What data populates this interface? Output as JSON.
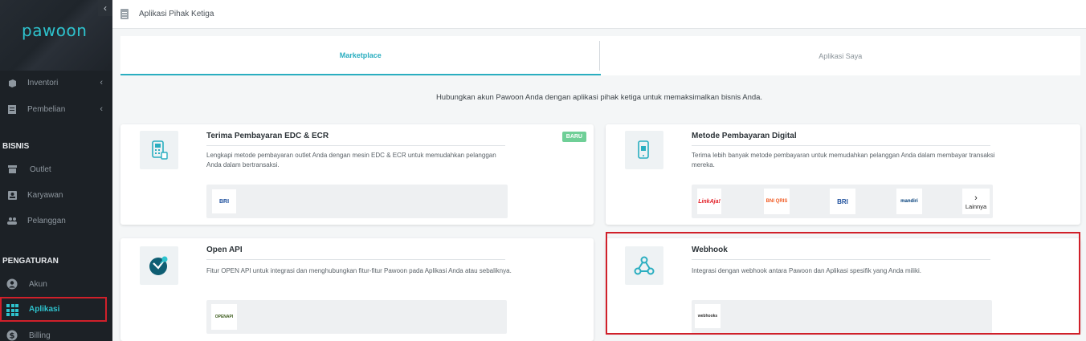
{
  "sidebar": {
    "logo": "pawoon",
    "collapse_icon": "‹",
    "items_top": [
      {
        "label": "Inventori",
        "icon": "box-icon"
      },
      {
        "label": "Pembelian",
        "icon": "clipboard-icon"
      }
    ],
    "section_bisnis": "BISNIS",
    "items_bisnis": [
      {
        "label": "Outlet",
        "icon": "store-icon"
      },
      {
        "label": "Karyawan",
        "icon": "id-card-icon"
      },
      {
        "label": "Pelanggan",
        "icon": "users-icon"
      }
    ],
    "section_pengaturan": "PENGATURAN",
    "items_pengaturan": [
      {
        "label": "Akun",
        "icon": "user-circle-icon"
      },
      {
        "label": "Aplikasi",
        "icon": "grid-icon"
      },
      {
        "label": "Billing",
        "icon": "dollar-icon"
      }
    ]
  },
  "header": {
    "breadcrumb": "Aplikasi Pihak Ketiga"
  },
  "tabs": [
    {
      "label": "Marketplace",
      "active": true
    },
    {
      "label": "Aplikasi Saya",
      "active": false
    }
  ],
  "intro": "Hubungkan akun Pawoon Anda dengan aplikasi pihak ketiga untuk memaksimalkan bisnis Anda.",
  "cards": {
    "edc": {
      "title": "Terima Pembayaran EDC & ECR",
      "badge": "BARU",
      "desc": "Lengkapi metode pembayaran outlet Anda dengan mesin EDC & ECR untuk memudahkan pelanggan Anda dalam bertransaksi.",
      "partners": [
        "BRI"
      ]
    },
    "digital": {
      "title": "Metode Pembayaran Digital",
      "desc": "Terima lebih banyak metode pembayaran untuk memudahkan pelanggan Anda dalam membayar transaksi mereka.",
      "partners": [
        "LinkAja!",
        "BNI QRIS",
        "BRI",
        "mandiri"
      ],
      "more_label": "Lainnya"
    },
    "openapi": {
      "title": "Open API",
      "desc": "Fitur OPEN API untuk integrasi dan menghubungkan fitur-fitur Pawoon pada Aplikasi Anda atau sebaliknya.",
      "partners": [
        "OPENAPI"
      ]
    },
    "webhook": {
      "title": "Webhook",
      "desc": "Integrasi dengan webhook antara Pawoon dan Aplikasi spesifik yang Anda miliki.",
      "partners": [
        "webhooks"
      ]
    }
  },
  "colors": {
    "accent": "#2aaec0",
    "sidebar": "#1c2126",
    "highlight": "#d0202a",
    "badge": "#6fcf97"
  }
}
